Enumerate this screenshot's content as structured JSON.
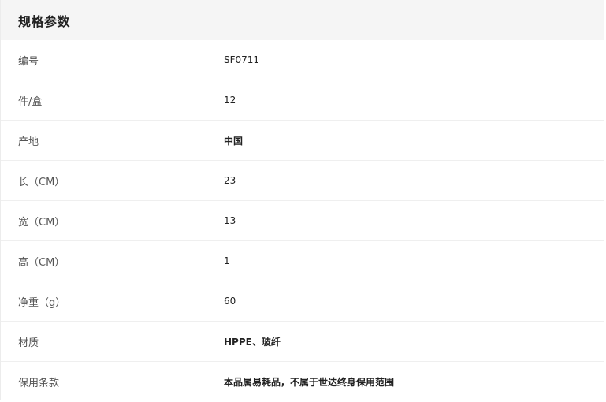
{
  "header": {
    "title": "规格参数"
  },
  "specs": [
    {
      "label": "编号",
      "value": "SF0711"
    },
    {
      "label": "件/盒",
      "value": "12"
    },
    {
      "label": "产地",
      "value": "中国"
    },
    {
      "label": "长（CM）",
      "value": "23"
    },
    {
      "label": "宽（CM）",
      "value": "13"
    },
    {
      "label": "高（CM）",
      "value": "1"
    },
    {
      "label": "净重（g）",
      "value": "60"
    },
    {
      "label": "材质",
      "value": "HPPE、玻纤"
    },
    {
      "label": "保用条款",
      "value": "本品属易耗品，不属于世达终身保用范围"
    }
  ]
}
